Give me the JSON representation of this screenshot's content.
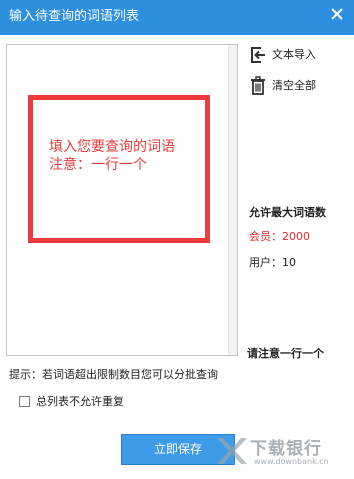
{
  "window": {
    "title": "输入待查询的词语列表",
    "close_icon": "close-icon"
  },
  "list_area": {
    "hint_line1": "填入您要查询的词语",
    "hint_line2": "注意：一行一个",
    "hint_color": "#e83c3c"
  },
  "sidebar": {
    "import_label": "文本导入",
    "import_icon": "import-icon",
    "clear_label": "清空全部",
    "clear_icon": "trash-icon"
  },
  "limits": {
    "title": "允许最大词语数",
    "member": "会员：2000",
    "user": "用户：10",
    "member_color": "#e52828"
  },
  "note": "请注意一行一个",
  "tip": "提示：若词语超出限制数目您可以分批查询",
  "checkbox": {
    "label": "总列表不允许重复",
    "checked": false
  },
  "save_button": {
    "label": "立即保存"
  },
  "watermark": {
    "text": "下载银行",
    "url": "www.downbank.cn"
  },
  "colors": {
    "titlebar": "#2c8fe0",
    "button": "#3d9be8"
  }
}
